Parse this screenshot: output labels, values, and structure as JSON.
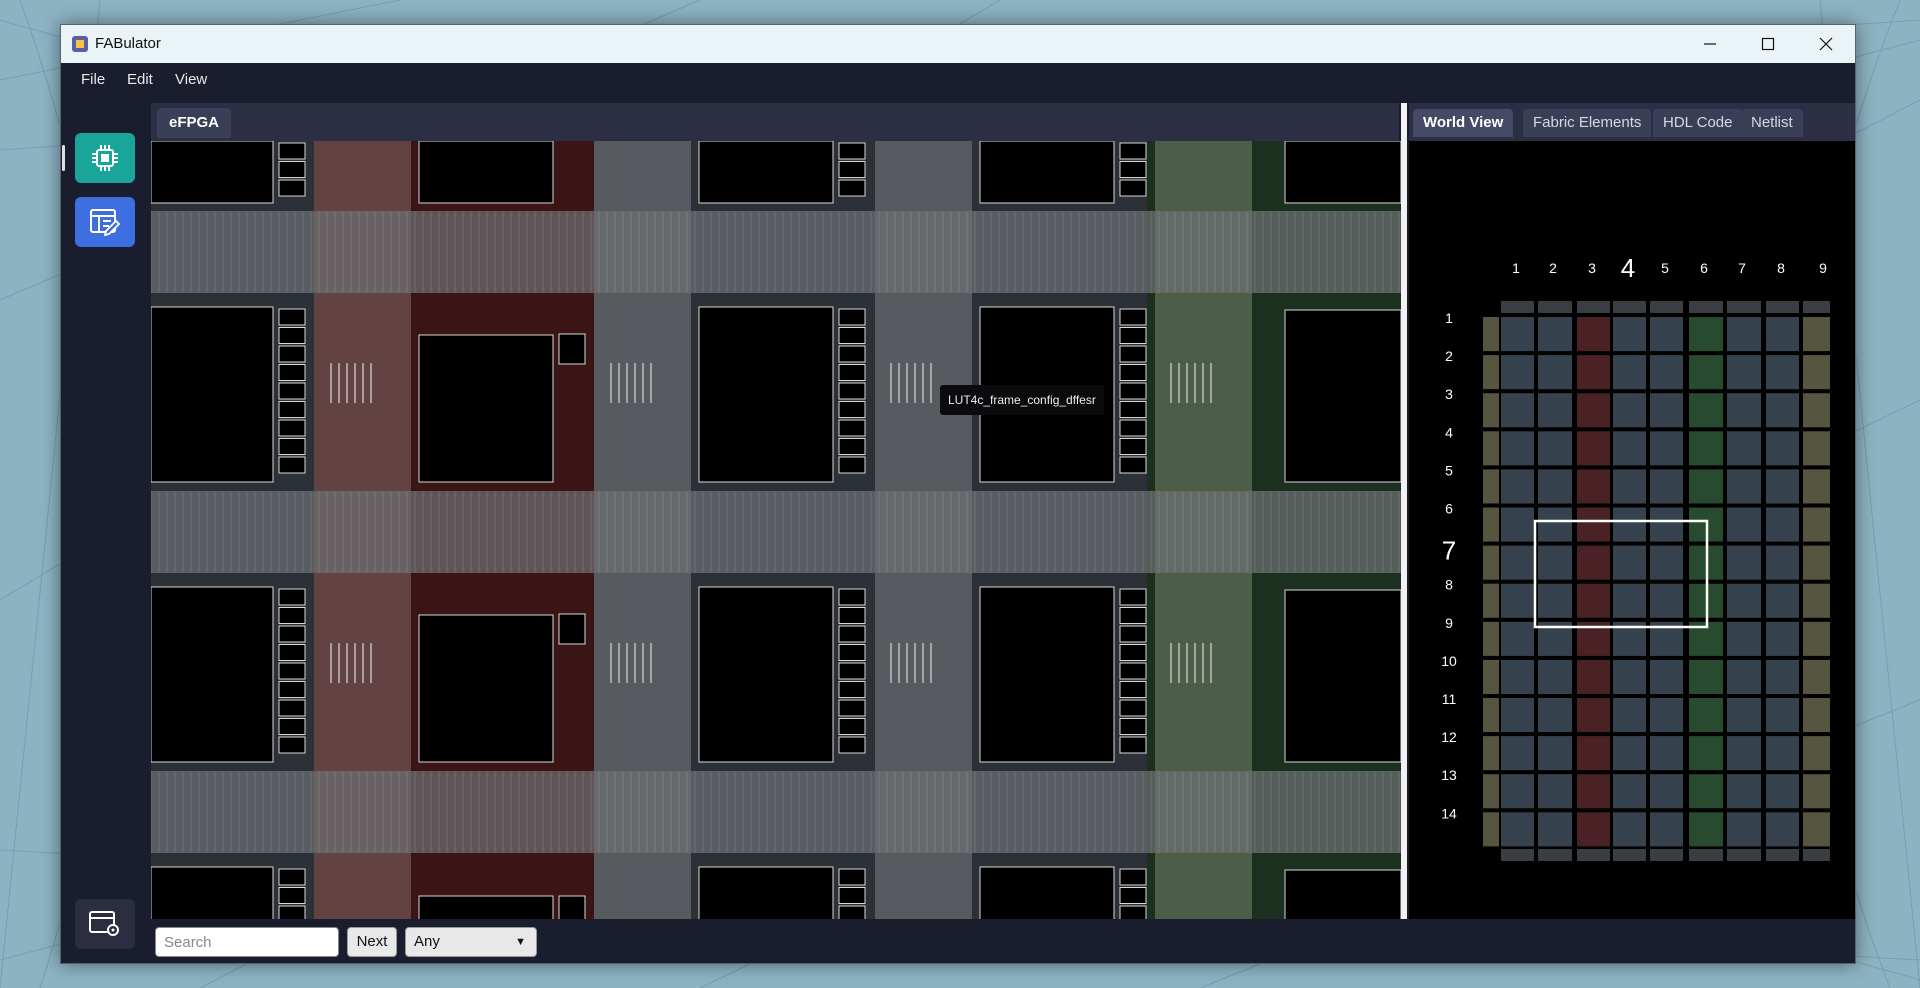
{
  "window": {
    "title": "FABulator",
    "controls": {
      "minimize": "—",
      "maximize": "☐",
      "close": "✕"
    }
  },
  "menu": {
    "items": [
      "File",
      "Edit",
      "View"
    ]
  },
  "sidebar": {
    "buttons": [
      {
        "name": "fabric-view",
        "icon": "chip-icon",
        "color": "#1aa59b",
        "active": true
      },
      {
        "name": "editor-view",
        "icon": "edit-layout-icon",
        "color": "#3d6fe0"
      },
      {
        "name": "settings",
        "icon": "window-settings-icon"
      }
    ]
  },
  "editor": {
    "tab_label": "eFPGA",
    "tooltip": "LUT4c_frame_config_dffesr"
  },
  "right_panel": {
    "tabs": [
      "World View",
      "Fabric Elements",
      "HDL Code",
      "Netlist"
    ],
    "active_tab": "World View",
    "world": {
      "columns": [
        "1",
        "2",
        "3",
        "4",
        "5",
        "6",
        "7",
        "8",
        "9"
      ],
      "rows": [
        "1",
        "2",
        "3",
        "4",
        "5",
        "6",
        "7",
        "8",
        "9",
        "10",
        "11",
        "12",
        "13",
        "14"
      ],
      "highlight_column": "4",
      "highlight_row": "7",
      "column_colors": [
        "#56553f",
        "#36434f",
        "#36434f",
        "#4a2125",
        "#36434f",
        "#36434f",
        "#284a2e",
        "#36434f",
        "#36434f",
        "#56553f"
      ]
    }
  },
  "bottom": {
    "search_placeholder": "Search",
    "next_label": "Next",
    "filter_value": "Any"
  },
  "colors": {
    "titlebar": "#eaf3f6",
    "window_bg": "#1a1d2e",
    "red_column": "#3b1416",
    "green_column": "#1c3020"
  }
}
